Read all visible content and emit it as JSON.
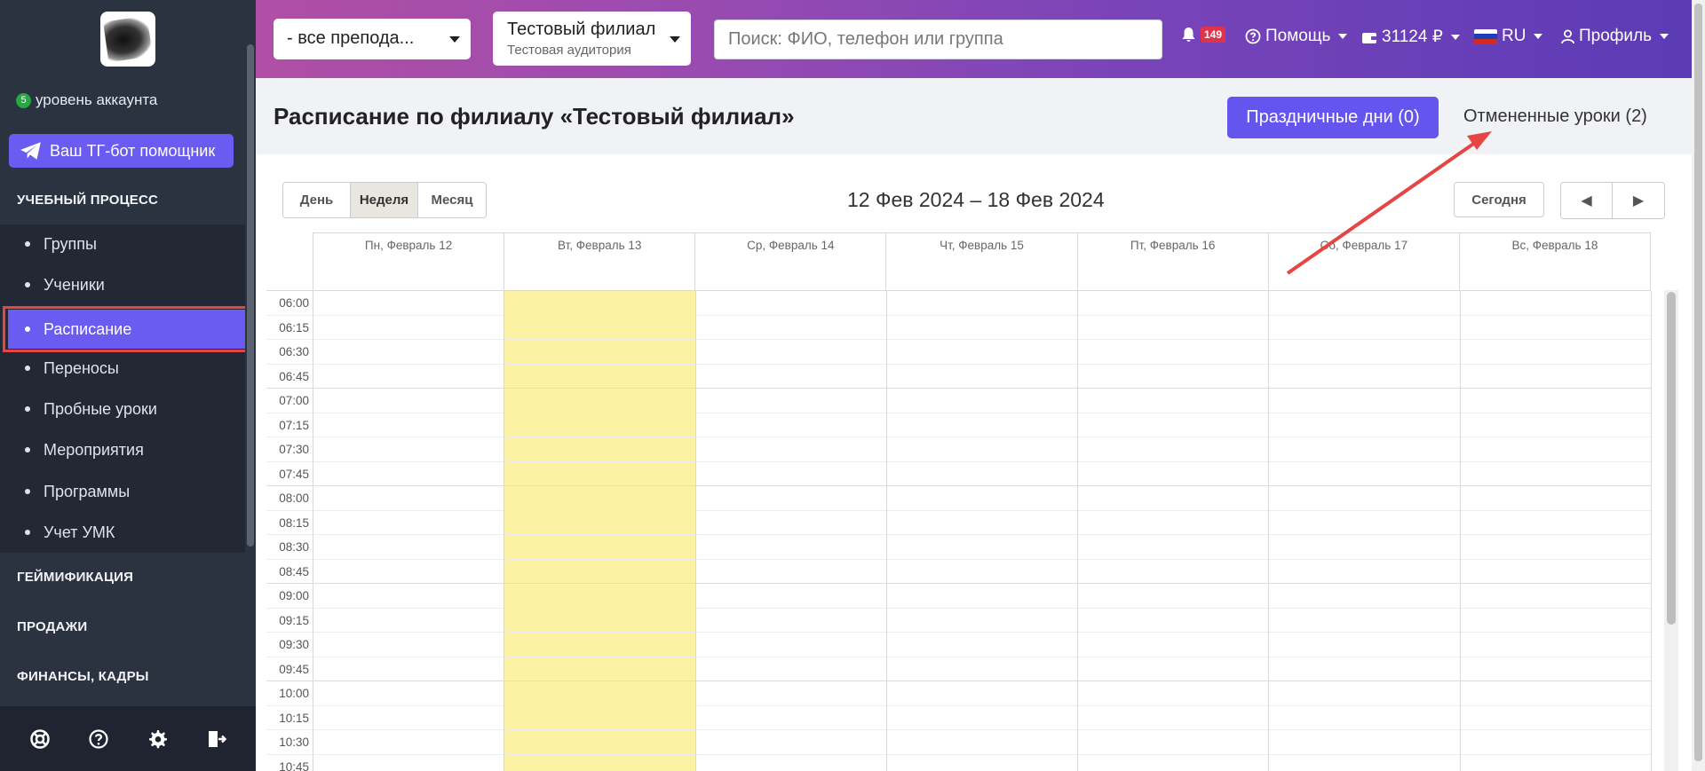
{
  "sidebar": {
    "account_level": "5",
    "account_level_label": "уровень аккаунта",
    "tg_button": "Ваш ТГ-бот помощник",
    "sections": {
      "learning": "УЧЕБНЫЙ ПРОЦЕСС",
      "gamification": "ГЕЙМИФИКАЦИЯ",
      "sales": "ПРОДАЖИ",
      "finance": "ФИНАНСЫ, КАДРЫ"
    },
    "items": [
      {
        "label": "Группы"
      },
      {
        "label": "Ученики"
      },
      {
        "label": "Расписание"
      },
      {
        "label": "Переносы"
      },
      {
        "label": "Пробные уроки"
      },
      {
        "label": "Мероприятия"
      },
      {
        "label": "Программы"
      },
      {
        "label": "Учет УМК"
      }
    ],
    "footer_icons": [
      "lifebuoy-icon",
      "help-circle-icon",
      "gear-icon",
      "logout-icon"
    ]
  },
  "topbar": {
    "teacher_select": "- все препода...",
    "branch_select": "Тестовый филиал",
    "branch_room": "Тестовая аудитория",
    "search_placeholder": "Поиск: ФИО, телефон или группа",
    "notifications_count": "149",
    "help": "Помощь",
    "balance": "31124 ₽",
    "language": "RU",
    "profile": "Профиль"
  },
  "page": {
    "title": "Расписание по филиалу «Тестовый филиал»",
    "holidays_button": "Праздничные дни (0)",
    "cancelled_link": "Отмененные уроки (2)"
  },
  "calendar": {
    "views": [
      "День",
      "Неделя",
      "Месяц"
    ],
    "active_view": "Неделя",
    "range": "12 Фев 2024 – 18 Фев 2024",
    "today_button": "Сегодня",
    "prev_icon": "◀",
    "next_icon": "▶",
    "days": [
      "Пн, Февраль 12",
      "Вт, Февраль 13",
      "Ср, Февраль 14",
      "Чт, Февраль 15",
      "Пт, Февраль 16",
      "Сб, Февраль 17",
      "Вс, Февраль 18"
    ],
    "highlighted_day": "Вт, Февраль 13",
    "highlight_color": "#fdf2a4",
    "times": [
      "06:00",
      "06:15",
      "06:30",
      "06:45",
      "07:00",
      "07:15",
      "07:30",
      "07:45",
      "08:00",
      "08:15",
      "08:30",
      "08:45",
      "09:00",
      "09:15",
      "09:30",
      "09:45",
      "10:00",
      "10:15",
      "10:30",
      "10:45"
    ]
  },
  "colors": {
    "accent": "#6a5cf0",
    "sidebar_bg": "#2b3240",
    "annotation_red": "#e54545"
  }
}
